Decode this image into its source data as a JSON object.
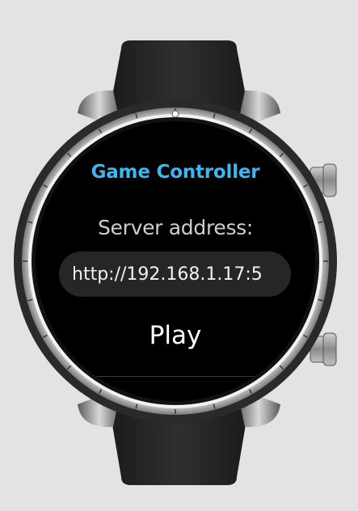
{
  "app": {
    "title": "Game Controller",
    "server_label": "Server address:",
    "server_address_value": "http://192.168.1.17:5",
    "play_label": "Play"
  },
  "colors": {
    "background": "#e3e3e3",
    "screen": "#000000",
    "title_accent": "#3fb6f0",
    "label_text": "#cfcfcf",
    "input_background": "#262626",
    "button_text": "#ffffff"
  },
  "icons": {
    "top_marker": "bezel-top-marker-icon",
    "crown_top": "crown-button-top",
    "crown_bottom": "crown-button-bottom"
  }
}
